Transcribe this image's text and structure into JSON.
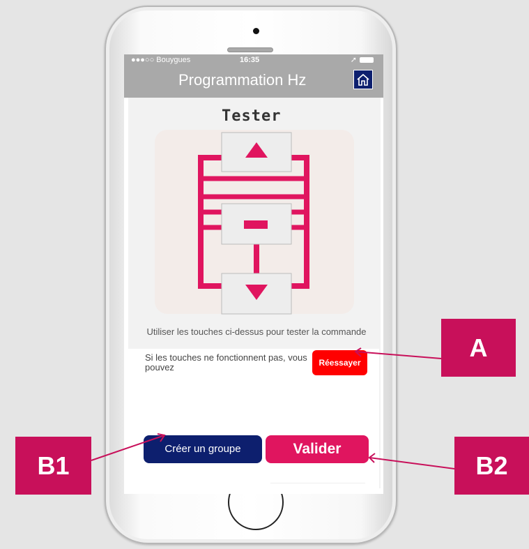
{
  "status_bar": {
    "carrier": "●●●○○ Bouygues",
    "time": "16:35"
  },
  "nav": {
    "title": "Programmation Hz"
  },
  "tester": {
    "title": "Tester"
  },
  "instructions": "Utiliser les touches ci-dessus pour tester la commande",
  "retry_note": "Si les touches ne fonctionnent pas, vous pouvez",
  "buttons": {
    "retry": "Réessayer",
    "create_group": "Créer un groupe",
    "validate": "Valider"
  },
  "callouts": {
    "a": "A",
    "b1": "B1",
    "b2": "B2"
  },
  "colors": {
    "accent_pink": "#e0155f",
    "navy": "#0d1f6e",
    "retry_red": "#ff0000",
    "callout": "#c8105a"
  }
}
